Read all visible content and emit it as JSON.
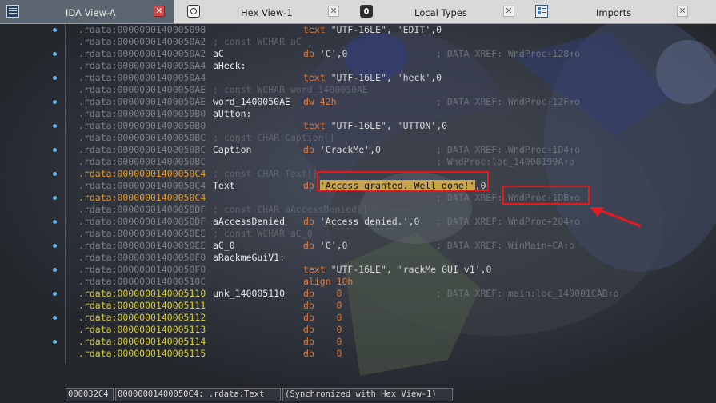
{
  "tabs": [
    {
      "label": "IDA View-A",
      "icon": "ida-view-icon",
      "active": true
    },
    {
      "label": "Hex View-1",
      "icon": "hex-view-icon",
      "active": false
    },
    {
      "label": "Local Types",
      "icon": "local-types-icon",
      "active": false
    },
    {
      "label": "Imports",
      "icon": "imports-icon",
      "active": false
    }
  ],
  "rows": [
    {
      "addr": ".rdata:0000000140005098",
      "ins_op": "text ",
      "ins_str": "\"UTF-16LE\", 'EDIT'",
      "ins_tail": ",0"
    },
    {
      "addr": ".rdata:00000001400050A2",
      "comment": "; const WCHAR aC"
    },
    {
      "addr": ".rdata:00000001400050A2",
      "label": "aC",
      "ins_op": "db ",
      "ins_str": "'C'",
      "ins_tail": ",0",
      "xref": "; DATA XREF: WndProc+128↑o"
    },
    {
      "addr": ".rdata:00000001400050A4",
      "label": "aHeck:"
    },
    {
      "addr": ".rdata:00000001400050A4",
      "ins_op": "text ",
      "ins_str": "\"UTF-16LE\", 'heck'",
      "ins_tail": ",0"
    },
    {
      "addr": ".rdata:00000001400050AE",
      "comment": "; const WCHAR word_1400050AE"
    },
    {
      "addr": ".rdata:00000001400050AE",
      "label": "word_1400050AE",
      "ins_op": "dw ",
      "ins_num": "42h",
      "xref": "; DATA XREF: WndProc+12F↑o"
    },
    {
      "addr": ".rdata:00000001400050B0",
      "label": "aUtton:"
    },
    {
      "addr": ".rdata:00000001400050B0",
      "ins_op": "text ",
      "ins_str": "\"UTF-16LE\", 'UTTON'",
      "ins_tail": ",0"
    },
    {
      "addr": ".rdata:00000001400050BC",
      "comment": "; const CHAR Caption[]"
    },
    {
      "addr": ".rdata:00000001400050BC",
      "label": "Caption",
      "ins_op": "db ",
      "ins_str": "'CrackMe'",
      "ins_tail": ",0",
      "xref": "; DATA XREF: WndProc+1D4↑o"
    },
    {
      "addr": ".rdata:00000001400050BC",
      "xref": "; WndProc:loc_14000199A↑o"
    },
    {
      "addr": ".rdata:00000001400050C4",
      "addr_color": "orange",
      "comment": "; const CHAR Text[]"
    },
    {
      "addr": ".rdata:00000001400050C4",
      "label": "Text",
      "ins_op": "db ",
      "ins_hl": "'Access granted. Well done!'",
      "ins_tail": ",0"
    },
    {
      "addr": ".rdata:00000001400050C4",
      "addr_color": "orange",
      "xref": "; DATA XREF: WndProc+1DB↑o"
    },
    {
      "addr": ".rdata:00000001400050DF",
      "comment": "; const CHAR aAccessDenied[]"
    },
    {
      "addr": ".rdata:00000001400050DF",
      "label": "aAccessDenied",
      "ins_op": "db ",
      "ins_str": "'Access denied.'",
      "ins_tail": ",0",
      "xref": "; DATA XREF: WndProc+204↑o"
    },
    {
      "addr": ".rdata:00000001400050EE",
      "comment": "; const WCHAR aC_0"
    },
    {
      "addr": ".rdata:00000001400050EE",
      "label": "aC_0",
      "ins_op": "db ",
      "ins_str": "'C'",
      "ins_tail": ",0",
      "xref": "; DATA XREF: WinMain+CA↑o"
    },
    {
      "addr": ".rdata:00000001400050F0",
      "label": "aRackmeGuiV1:"
    },
    {
      "addr": ".rdata:00000001400050F0",
      "ins_op": "text ",
      "ins_str": "\"UTF-16LE\", 'rackMe GUI v1'",
      "ins_tail": ",0"
    },
    {
      "addr": ".rdata:000000014000510C",
      "ins_op": "align ",
      "ins_num": "10h"
    },
    {
      "addr": ".rdata:0000000140005110",
      "addr_color": "yellow",
      "label": "unk_140005110",
      "ins_op": "db    ",
      "ins_num": "0",
      "xref": "; DATA XREF: main:loc_140001CAB↑o"
    },
    {
      "addr": ".rdata:0000000140005111",
      "addr_color": "yellow",
      "ins_op": "db    ",
      "ins_num": "0"
    },
    {
      "addr": ".rdata:0000000140005112",
      "addr_color": "yellow",
      "ins_op": "db    ",
      "ins_num": "0"
    },
    {
      "addr": ".rdata:0000000140005113",
      "addr_color": "yellow",
      "ins_op": "db    ",
      "ins_num": "0"
    },
    {
      "addr": ".rdata:0000000140005114",
      "addr_color": "yellow",
      "ins_op": "db    ",
      "ins_num": "0"
    },
    {
      "addr": ".rdata:0000000140005115",
      "addr_color": "yellow",
      "ins_op": "db    ",
      "ins_num": "0"
    }
  ],
  "status": {
    "offset": "000032C4",
    "location": "00000001400050C4: .rdata:Text",
    "sync": "(Synchronized with Hex View-1)"
  },
  "colors": {
    "highlight_box": "#e8191e",
    "address_yellow": "#d4cc3a",
    "address_orange": "#e39a2b",
    "string_highlight": "#c9a34a",
    "bullet": "#67b6e8"
  }
}
